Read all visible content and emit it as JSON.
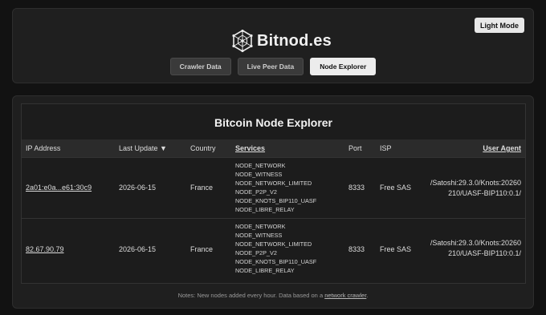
{
  "header": {
    "brand": "Bitnod.es",
    "logo_icon": "hexagon-network-icon",
    "light_mode_label": "Light Mode",
    "tabs": [
      {
        "label": "Crawler Data",
        "active": false
      },
      {
        "label": "Live Peer Data",
        "active": false
      },
      {
        "label": "Node Explorer",
        "active": true
      }
    ]
  },
  "explorer": {
    "title": "Bitcoin Node Explorer",
    "columns": {
      "ip": "IP Address",
      "last_update": "Last Update ▼",
      "country": "Country",
      "services": "Services",
      "port": "Port",
      "isp": "ISP",
      "user_agent": "User Agent"
    },
    "rows": [
      {
        "ip": "2a01:e0a...e61:30c9",
        "last_update": "2026-06-15",
        "country": "France",
        "services": [
          "NODE_NETWORK",
          "NODE_WITNESS",
          "NODE_NETWORK_LIMITED",
          "NODE_P2P_V2",
          "NODE_KNOTS_BIP110_UASF",
          "NODE_LIBRE_RELAY"
        ],
        "port": "8333",
        "isp": "Free SAS",
        "user_agent_1": "/Satoshi:29.3.0/Knots:20260",
        "user_agent_2": "210/UASF-BIP110:0.1/"
      },
      {
        "ip": "82.67.90.79",
        "last_update": "2026-06-15",
        "country": "France",
        "services": [
          "NODE_NETWORK",
          "NODE_WITNESS",
          "NODE_NETWORK_LIMITED",
          "NODE_P2P_V2",
          "NODE_KNOTS_BIP110_UASF",
          "NODE_LIBRE_RELAY"
        ],
        "port": "8333",
        "isp": "Free SAS",
        "user_agent_1": "/Satoshi:29.3.0/Knots:20260",
        "user_agent_2": "210/UASF-BIP110:0.1/"
      }
    ],
    "notes_prefix": "Notes: New nodes added every hour. Data based on a ",
    "notes_link": "network crawler",
    "notes_suffix": "."
  },
  "colors": {
    "background": "#121212",
    "card": "#1f1f1f",
    "table_header": "#2b2b2b",
    "active_tab": "#ececec"
  }
}
